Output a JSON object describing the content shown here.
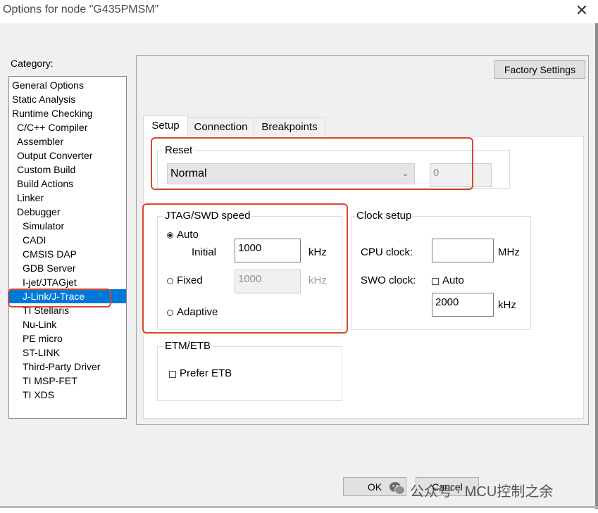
{
  "window": {
    "title": "Options for node \"G435PMSM\"",
    "close_glyph": "✕"
  },
  "category": {
    "label": "Category:",
    "items": [
      {
        "label": "General Options",
        "indent": 0
      },
      {
        "label": "Static Analysis",
        "indent": 0
      },
      {
        "label": "Runtime Checking",
        "indent": 0
      },
      {
        "label": "C/C++ Compiler",
        "indent": 1
      },
      {
        "label": "Assembler",
        "indent": 1
      },
      {
        "label": "Output Converter",
        "indent": 1
      },
      {
        "label": "Custom Build",
        "indent": 1
      },
      {
        "label": "Build Actions",
        "indent": 1
      },
      {
        "label": "Linker",
        "indent": 1
      },
      {
        "label": "Debugger",
        "indent": 1
      },
      {
        "label": "Simulator",
        "indent": 2
      },
      {
        "label": "CADI",
        "indent": 2
      },
      {
        "label": "CMSIS DAP",
        "indent": 2
      },
      {
        "label": "GDB Server",
        "indent": 2
      },
      {
        "label": "I-jet/JTAGjet",
        "indent": 2
      },
      {
        "label": "J-Link/J-Trace",
        "indent": 2,
        "selected": true
      },
      {
        "label": "TI Stellaris",
        "indent": 2
      },
      {
        "label": "Nu-Link",
        "indent": 2
      },
      {
        "label": "PE micro",
        "indent": 2
      },
      {
        "label": "ST-LINK",
        "indent": 2
      },
      {
        "label": "Third-Party Driver",
        "indent": 2
      },
      {
        "label": "TI MSP-FET",
        "indent": 2
      },
      {
        "label": "TI XDS",
        "indent": 2
      }
    ]
  },
  "factory_settings_label": "Factory Settings",
  "tabs": [
    {
      "label": "Setup",
      "active": true
    },
    {
      "label": "Connection"
    },
    {
      "label": "Breakpoints"
    }
  ],
  "reset": {
    "label": "Reset",
    "selected": "Normal",
    "delay_value": "0"
  },
  "jtag": {
    "label": "JTAG/SWD speed",
    "auto_label": "Auto",
    "initial_label": "Initial",
    "initial_value": "1000",
    "initial_unit": "kHz",
    "fixed_label": "Fixed",
    "fixed_value": "1000",
    "fixed_unit": "kHz",
    "adaptive_label": "Adaptive",
    "selected": "auto"
  },
  "clock": {
    "label": "Clock setup",
    "cpu_label": "CPU clock:",
    "cpu_value": "",
    "cpu_unit": "MHz",
    "swo_label": "SWO clock:",
    "swo_auto_label": "Auto",
    "swo_value": "2000",
    "swo_unit": "kHz"
  },
  "etm": {
    "label": "ETM/ETB",
    "prefer_label": "Prefer ETB"
  },
  "buttons": {
    "ok_label": "OK",
    "cancel_label": "Cancel"
  },
  "watermark": {
    "text": "公众号 · MCU控制之余"
  },
  "colors": {
    "selection": "#0078d7",
    "highlight": "#d9472b"
  }
}
